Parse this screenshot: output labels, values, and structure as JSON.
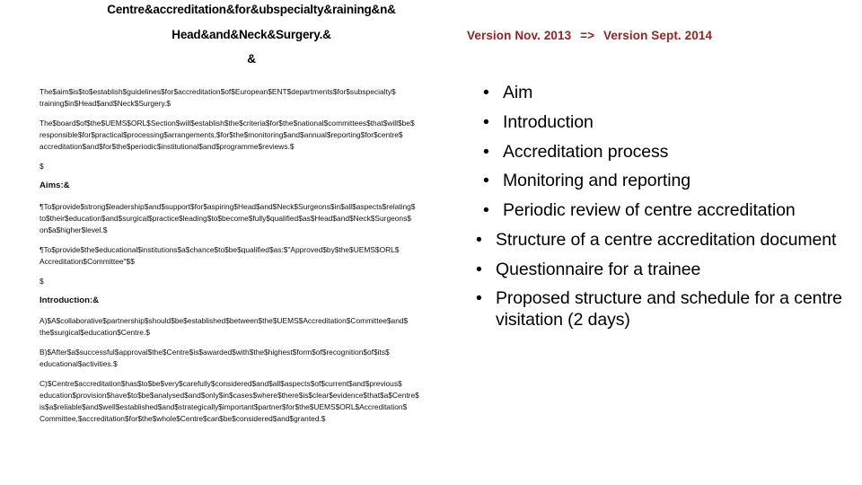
{
  "slide": {
    "title": {
      "line1": "Centre&accreditation&for&ubspecialty&raining&n&",
      "line2": "Head&and&Neck&Surgery.&",
      "line3": "&"
    },
    "version_banner": {
      "from": "Version Nov. 2013",
      "arrow": "=>",
      "to": "Version Sept. 2014",
      "color": "#9e2021"
    },
    "left_column": {
      "paragraphs": [
        "The$aim$is$to$establish$guidelines$for$accreditation$of$European$ENT$departments$for$subspecialty$ training$in$Head$and$Neck$Surgery.$",
        "The$board$of$the$UEMS$ORL$Section$will$establish$the$criteria$for$the$national$committees$that$will$be$ responsible$for$practical$processing$arrangements,$for$the$monitoring$and$annual$reporting$for$centre$ accreditation$and$for$the$periodic$institutional$and$programme$reviews.$",
        "$"
      ],
      "aims_heading": "Aims:&",
      "aims_paragraphs": [
        "¶To$provide$strong$leadership$and$support$for$aspiring$Head$and$Neck$Surgeons$in$all$aspects$relating$ to$their$education$and$surgical$practice$leading$to$become$fully$qualified$as$Head$and$Neck$Surgeons$ on$a$higher$level.$",
        "¶To$provide$the$educational$institutions$a$chance$to$be$qualified$as:$\"Approved$by$the$UEMS$ORL$ Accreditation$Committee\"$$",
        "$"
      ],
      "introduction_heading": "Introduction:&",
      "introduction_paragraphs": [
        "A)$A$collaborative$partnership$should$be$established$between$the$UEMS$Accreditation$Committee$and$ the$surgical$education$Centre.$",
        "B)$After$a$successful$approval$the$Centre$is$awarded$with$the$highest$form$of$recognition$of$its$ educational$activities.$",
        "C)$Centre$accreditation$has$to$be$very$carefully$considered$and$all$aspects$of$current$and$previous$ education$provision$have$to$be$analysed$and$only$in$cases$where$there$is$clear$evidence$that$a$Centre$ is$a$reliable$and$well$established$and$strategically$important$partner$for$the$UEMS$ORL$Accreditation$ Committee,$accreditation$for$the$whole$Centre$can$be$considered$and$granted.$"
      ]
    },
    "right_column": {
      "bullet_char": "•",
      "items": [
        "Aim",
        "Introduction",
        "Accreditation process",
        "Monitoring and reporting",
        "Periodic review of centre accreditation",
        "Structure of a centre accreditation document",
        "Questionnaire for a trainee",
        "Proposed structure and schedule for a centre visitation (2 days)"
      ]
    }
  }
}
